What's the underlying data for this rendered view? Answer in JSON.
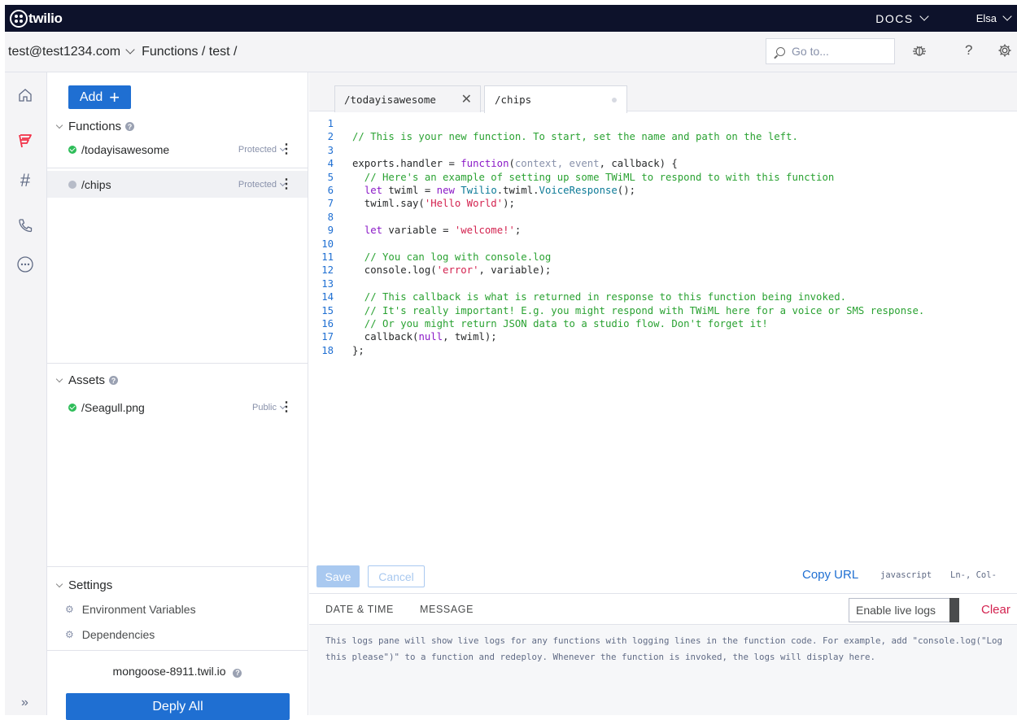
{
  "header": {
    "brand": "twilio",
    "docs_label": "DOCS",
    "user_label": "Elsa"
  },
  "breadcrumb": {
    "account": "test@test1234.com",
    "path": "Functions / test /"
  },
  "goto": {
    "placeholder": "Go to..."
  },
  "sidebar_panel": {
    "add_label": "Add",
    "functions_title": "Functions",
    "functions": [
      {
        "name": "/todayisawesome",
        "access": "Protected",
        "status": "deployed"
      },
      {
        "name": "/chips",
        "access": "Protected",
        "status": "undeployed"
      }
    ],
    "assets_title": "Assets",
    "assets": [
      {
        "name": "/Seagull.png",
        "access": "Public",
        "status": "deployed"
      }
    ],
    "settings_title": "Settings",
    "settings": [
      {
        "label": "Environment Variables"
      },
      {
        "label": "Dependencies"
      }
    ],
    "domain": "mongoose-8911.twil.io",
    "deploy_label": "Deply All"
  },
  "editor": {
    "tabs": [
      {
        "label": "/todayisawesome"
      },
      {
        "label": "/chips"
      }
    ],
    "lines": [
      "",
      "// This is your new function. To start, set the name and path on the left.",
      "",
      "exports.handler = function(context, event, callback) {",
      "  // Here's an example of setting up some TWiML to respond to with this function",
      "  let twiml = new Twilio.twiml.VoiceResponse();",
      "  twiml.say('Hello World');",
      "",
      "  let variable = 'welcome!';",
      "",
      "  // You can log with console.log",
      "  console.log('error', variable);",
      "",
      "  // This callback is what is returned in response to this function being invoked.",
      "  // It's really important! E.g. you might respond with TWiML here for a voice or SMS response.",
      "  // Or you might return JSON data to a studio flow. Don't forget it!",
      "  callback(null, twiml);",
      "};"
    ],
    "save_label": "Save",
    "cancel_label": "Cancel",
    "copy_url_label": "Copy URL",
    "language": "javascript",
    "cursor": "Ln-, Col-"
  },
  "logs": {
    "col_datetime": "DATE & TIME",
    "col_message": "MESSAGE",
    "live_label": "Enable live logs",
    "clear_label": "Clear",
    "body": "This logs pane will show live logs for any functions with logging lines in the function code. For example, add \"console.log(\"Log this please\")\" to a function and redeploy. Whenever the function is invoked, the logs will display here."
  },
  "colors": {
    "header_bg": "#0d122b",
    "primary": "#1f6fd2",
    "brand_red": "#f22f46",
    "success": "#2ebd59",
    "danger": "#d3224f"
  },
  "icons": [
    "home-icon",
    "functions-icon",
    "hash-icon",
    "phone-icon",
    "more-icon",
    "bug-icon",
    "help-icon",
    "settings-icon",
    "search-icon",
    "expand-icon"
  ]
}
